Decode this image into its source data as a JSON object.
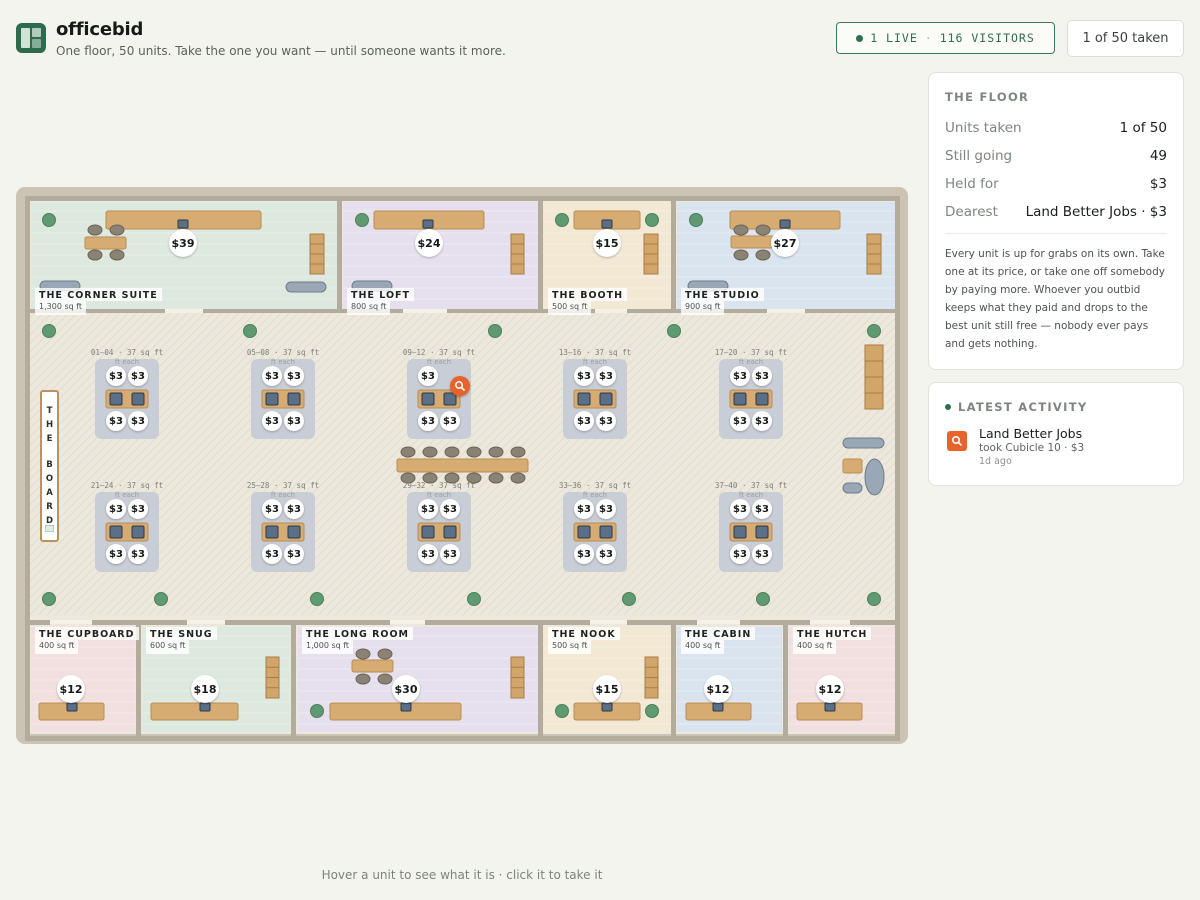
{
  "app": {
    "name": "officebid",
    "tagline": "One floor, 50 units. Take the one you want — until someone wants it more."
  },
  "live": {
    "live_text": "1 LIVE",
    "sep": "·",
    "visitors_text": "116 VISITORS"
  },
  "taken_summary": "1 of 50 taken",
  "floor_panel": {
    "title": "THE FLOOR",
    "rows": [
      {
        "label": "Units taken",
        "value": "1 of 50"
      },
      {
        "label": "Still going",
        "value": "49"
      },
      {
        "label": "Held for",
        "value": "$3"
      },
      {
        "label": "Dearest",
        "value": "Land Better Jobs · $3"
      }
    ],
    "description": "Every unit is up for grabs on its own. Take one at its price, or take one off somebody by paying more. Whoever you outbid keeps what they paid and drops to the best unit still free — nobody ever pays and gets nothing."
  },
  "activity": {
    "title": "LATEST ACTIVITY",
    "items": [
      {
        "name": "Land Better Jobs",
        "detail": "took Cubicle 10 · $3",
        "time": "1d ago",
        "icon": "magnifier-logo-icon"
      }
    ]
  },
  "hint": "Hover a unit to see what it is · click it to take it",
  "rooms": [
    {
      "name": "THE CORNER SUITE",
      "size": "1,300 sq ft",
      "price": "$39"
    },
    {
      "name": "THE LOFT",
      "size": "800 sq ft",
      "price": "$24"
    },
    {
      "name": "THE BOOTH",
      "size": "500 sq ft",
      "price": "$15"
    },
    {
      "name": "THE STUDIO",
      "size": "900 sq ft",
      "price": "$27"
    },
    {
      "name": "THE CUPBOARD",
      "size": "400 sq ft",
      "price": "$12"
    },
    {
      "name": "THE SNUG",
      "size": "600 sq ft",
      "price": "$18"
    },
    {
      "name": "THE LONG ROOM",
      "size": "1,000 sq ft",
      "price": "$30"
    },
    {
      "name": "THE NOOK",
      "size": "500 sq ft",
      "price": "$15"
    },
    {
      "name": "THE CABIN",
      "size": "400 sq ft",
      "price": "$12"
    },
    {
      "name": "THE HUTCH",
      "size": "400 sq ft",
      "price": "$12"
    }
  ],
  "clusters": [
    {
      "label": "01–04 · 37 sq ft each",
      "prices": [
        "$3",
        "$3",
        "$3",
        "$3"
      ]
    },
    {
      "label": "05–08 · 37 sq ft each",
      "prices": [
        "$3",
        "$3",
        "$3",
        "$3"
      ]
    },
    {
      "label": "09–12 · 37 sq ft each",
      "prices": [
        "$3",
        "",
        "$3",
        "$3"
      ]
    },
    {
      "label": "13–16 · 37 sq ft each",
      "prices": [
        "$3",
        "$3",
        "$3",
        "$3"
      ]
    },
    {
      "label": "17–20 · 37 sq ft each",
      "prices": [
        "$3",
        "$3",
        "$3",
        "$3"
      ]
    },
    {
      "label": "21–24 · 37 sq ft each",
      "prices": [
        "$3",
        "$3",
        "$3",
        "$3"
      ]
    },
    {
      "label": "25–28 · 37 sq ft each",
      "prices": [
        "$3",
        "$3",
        "$3",
        "$3"
      ]
    },
    {
      "label": "29–32 · 37 sq ft each",
      "prices": [
        "$3",
        "$3",
        "$3",
        "$3"
      ]
    },
    {
      "label": "33–36 · 37 sq ft each",
      "prices": [
        "$3",
        "$3",
        "$3",
        "$3"
      ]
    },
    {
      "label": "37–40 · 37 sq ft each",
      "prices": [
        "$3",
        "$3",
        "$3",
        "$3"
      ]
    }
  ],
  "board_label": "THE BOARD",
  "colors": {
    "brand": "#2e6b4d",
    "accent_orange": "#e8632b",
    "room_green": "#dde9de",
    "room_purple": "#e6e0ee",
    "room_yellow": "#f2e8d3",
    "room_blue": "#dae4ee",
    "room_pink": "#f2dfe0",
    "desk": "#d7ac72",
    "cluster": "#c9cdd6"
  }
}
